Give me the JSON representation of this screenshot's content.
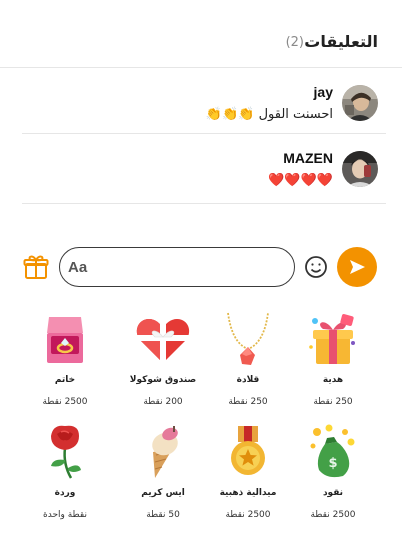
{
  "header": {
    "title": "التعليقات",
    "count": "(2)"
  },
  "comments": [
    {
      "author": "jay",
      "text": "احسنت القول",
      "emoji": "👏👏👏"
    },
    {
      "author": "MAZEN",
      "text": "",
      "emoji": "❤️❤️❤️❤️"
    }
  ],
  "composer": {
    "placeholder": "Aa",
    "value": ""
  },
  "colors": {
    "accent": "#f39200",
    "divider": "#e6e6e6"
  },
  "gifts": [
    {
      "name": "هدية",
      "price": "250 نقطة",
      "icon": "gift-box-icon"
    },
    {
      "name": "قلادة",
      "price": "250 نقطة",
      "icon": "necklace-icon"
    },
    {
      "name": "صندوق شوكولا",
      "price": "200 نقطة",
      "icon": "chocolate-box-icon"
    },
    {
      "name": "خاتم",
      "price": "2500 نقطة",
      "icon": "ring-icon"
    },
    {
      "name": "نقود",
      "price": "2500 نقطة",
      "icon": "money-bag-icon"
    },
    {
      "name": "ميدالية ذهبية",
      "price": "2500 نقطة",
      "icon": "gold-medal-icon"
    },
    {
      "name": "ايس كريم",
      "price": "50 نقطة",
      "icon": "ice-cream-icon"
    },
    {
      "name": "وردة",
      "price": "نقطة واحدة",
      "icon": "rose-icon"
    }
  ]
}
